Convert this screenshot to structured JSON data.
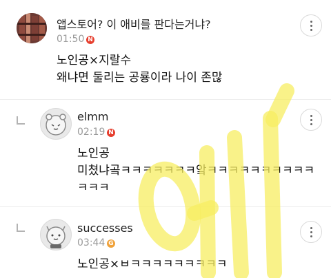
{
  "comments": [
    {
      "author": "앱스토어? 이 애비를 판다는거냐?",
      "time": "01:50",
      "badge": "N",
      "badge_color": "#e63e2e",
      "lines": [
        "노인공×지랄수",
        "왜냐면 둘리는 공룡이라 나이 존많"
      ]
    },
    {
      "author": "elmm",
      "time": "02:19",
      "badge": "N",
      "badge_color": "#e63e2e",
      "lines": [
        "노인공",
        "미쳤냐곸ㅋㅋㅋㅋㅋㅋㅋ앜ㅋㅋㅋㅋㅋㅋㅋㅋㅋㅋ",
        "ㅋㅋㅋ"
      ]
    },
    {
      "author": "successes",
      "time": "03:44",
      "badge": "G",
      "badge_color": "#f0a23a",
      "lines": [
        "노인공×ㅂㅋㅋㅋㅋㅋㅋㅋㅋㅋ"
      ]
    }
  ],
  "watermark": {
    "text": "애비",
    "color": "#f7ee62"
  },
  "icons": {
    "more": "more-options-icon",
    "reply": "reply-indent-icon"
  }
}
